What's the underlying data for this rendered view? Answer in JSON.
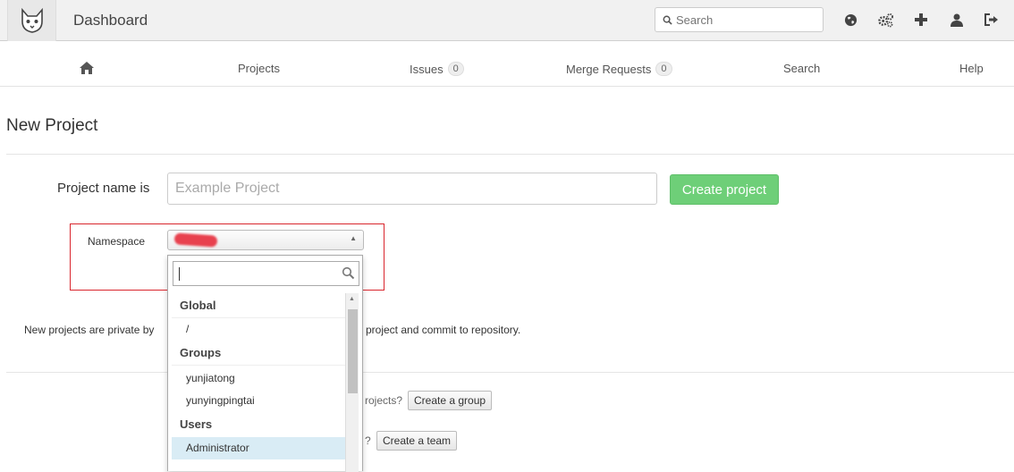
{
  "header": {
    "title": "Dashboard",
    "search_placeholder": "Search",
    "icons": [
      "globe-icon",
      "gears-icon",
      "plus-icon",
      "user-icon",
      "sign-out-icon"
    ]
  },
  "nav": {
    "projects": "Projects",
    "issues": "Issues",
    "issues_count": "0",
    "merge_requests": "Merge Requests",
    "merge_requests_count": "0",
    "search": "Search",
    "help": "Help"
  },
  "page": {
    "title": "New Project",
    "project_name_label": "Project name is",
    "project_name_placeholder": "Example Project",
    "create_button": "Create project",
    "namespace_label": "Namespace",
    "private_note_start": "New projects are private by",
    "private_note_end": "project and commit to repository.",
    "group_question_tail": "rojects?",
    "create_group_button": "Create a group",
    "team_question_tail": "?",
    "create_team_button": "Create a team"
  },
  "dropdown": {
    "search_value": "",
    "groups": [
      {
        "label": "Global",
        "options": [
          "/"
        ]
      },
      {
        "label": "Groups",
        "options": [
          "yunjiatong",
          "yunyingpingtai"
        ]
      },
      {
        "label": "Users",
        "options": [
          "Administrator"
        ]
      }
    ],
    "selected": "Administrator"
  },
  "colors": {
    "create_button": "#6ecf78",
    "highlight_border": "#d9262d",
    "selected_option": "#d9ecf5"
  }
}
